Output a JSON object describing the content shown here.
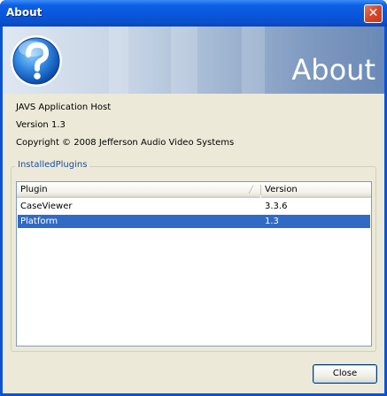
{
  "window": {
    "title": "About"
  },
  "banner": {
    "title": "About"
  },
  "info": {
    "app_name": "JAVS Application Host",
    "version": "Version  1.3",
    "copyright": "Copyright © 2008 Jefferson Audio Video Systems"
  },
  "plugins": {
    "group_label": "InstalledPlugins",
    "columns": [
      "Plugin",
      "Version"
    ],
    "rows": [
      {
        "name": "CaseViewer",
        "version": "3.3.6"
      },
      {
        "name": "Platform",
        "version": "1.3"
      }
    ],
    "selected_row": "Platform"
  },
  "buttons": {
    "close_label": "Close"
  },
  "colors": {
    "titlebar": "#0a55d8",
    "selection": "#316ac5",
    "dialog_bg": "#ece9d8",
    "group_label": "#1a4ea0"
  }
}
